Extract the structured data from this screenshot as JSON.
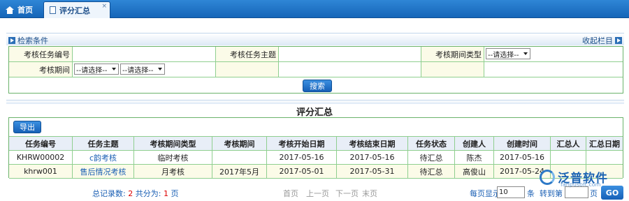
{
  "tabs": {
    "home": "首页",
    "active": "评分汇总",
    "close": "×"
  },
  "search": {
    "title": "检索条件",
    "collapse": "收起栏目",
    "task_no_label": "考核任务编号",
    "task_subject_label": "考核任务主题",
    "period_type_label": "考核期间类型",
    "period_type_value": "--请选择--",
    "period_label": "考核期间",
    "period_select1": "--请选择--",
    "period_select2": "--请选择--",
    "search_button": "搜索"
  },
  "results": {
    "title": "评分汇总",
    "export_button": "导出",
    "columns": [
      "任务编号",
      "任务主题",
      "考核期间类型",
      "考核期间",
      "考核开始日期",
      "考核结束日期",
      "任务状态",
      "创建人",
      "创建时间",
      "汇总人",
      "汇总日期"
    ],
    "rows": [
      [
        "KHRW00002",
        "c韵考核",
        "临时考核",
        "",
        "2017-05-16",
        "2017-05-16",
        "待汇总",
        "陈杰",
        "2017-05-16",
        "",
        ""
      ],
      [
        "khrw001",
        "售后情况考核",
        "月考核",
        "2017年5月",
        "2017-05-01",
        "2017-05-31",
        "待汇总",
        "高俊山",
        "2017-05-24",
        "",
        ""
      ]
    ]
  },
  "footer": {
    "total_label": "总记录数:",
    "total": "2",
    "pages_label": "共分为:",
    "pages": "1",
    "pages_unit": "页",
    "first": "首页",
    "prev": "上一页",
    "next": "下一页",
    "last": "末页",
    "page_size_label": "每页显示",
    "page_size": "10",
    "page_size_unit": "条",
    "goto_label": "转到第",
    "goto_unit": "页",
    "go": "GO"
  },
  "logo": {
    "name": "泛普软件",
    "url": "fanpusoft.com"
  }
}
